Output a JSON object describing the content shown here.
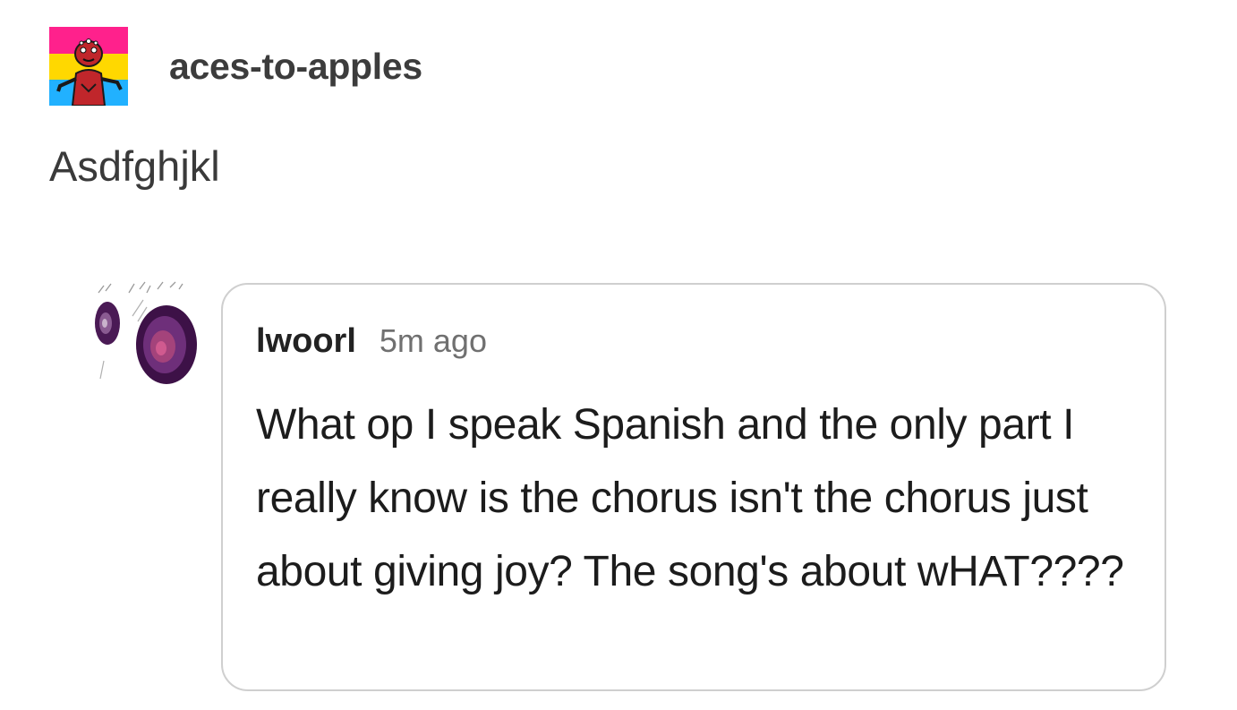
{
  "post": {
    "username": "aces-to-apples",
    "body": "Asdfghjkl"
  },
  "reply": {
    "username": "lwoorl",
    "time": "5m ago",
    "text": "What op I speak Spanish and the only part I really know is the chorus isn't the chorus just about giving joy? The song's about wHAT????"
  },
  "colors": {
    "pride_pink": "#ff218c",
    "pride_yellow": "#ffd800",
    "pride_blue": "#21b1ff",
    "reply_border": "#cfcfcf",
    "avatar_purple": "#4a1a55"
  }
}
